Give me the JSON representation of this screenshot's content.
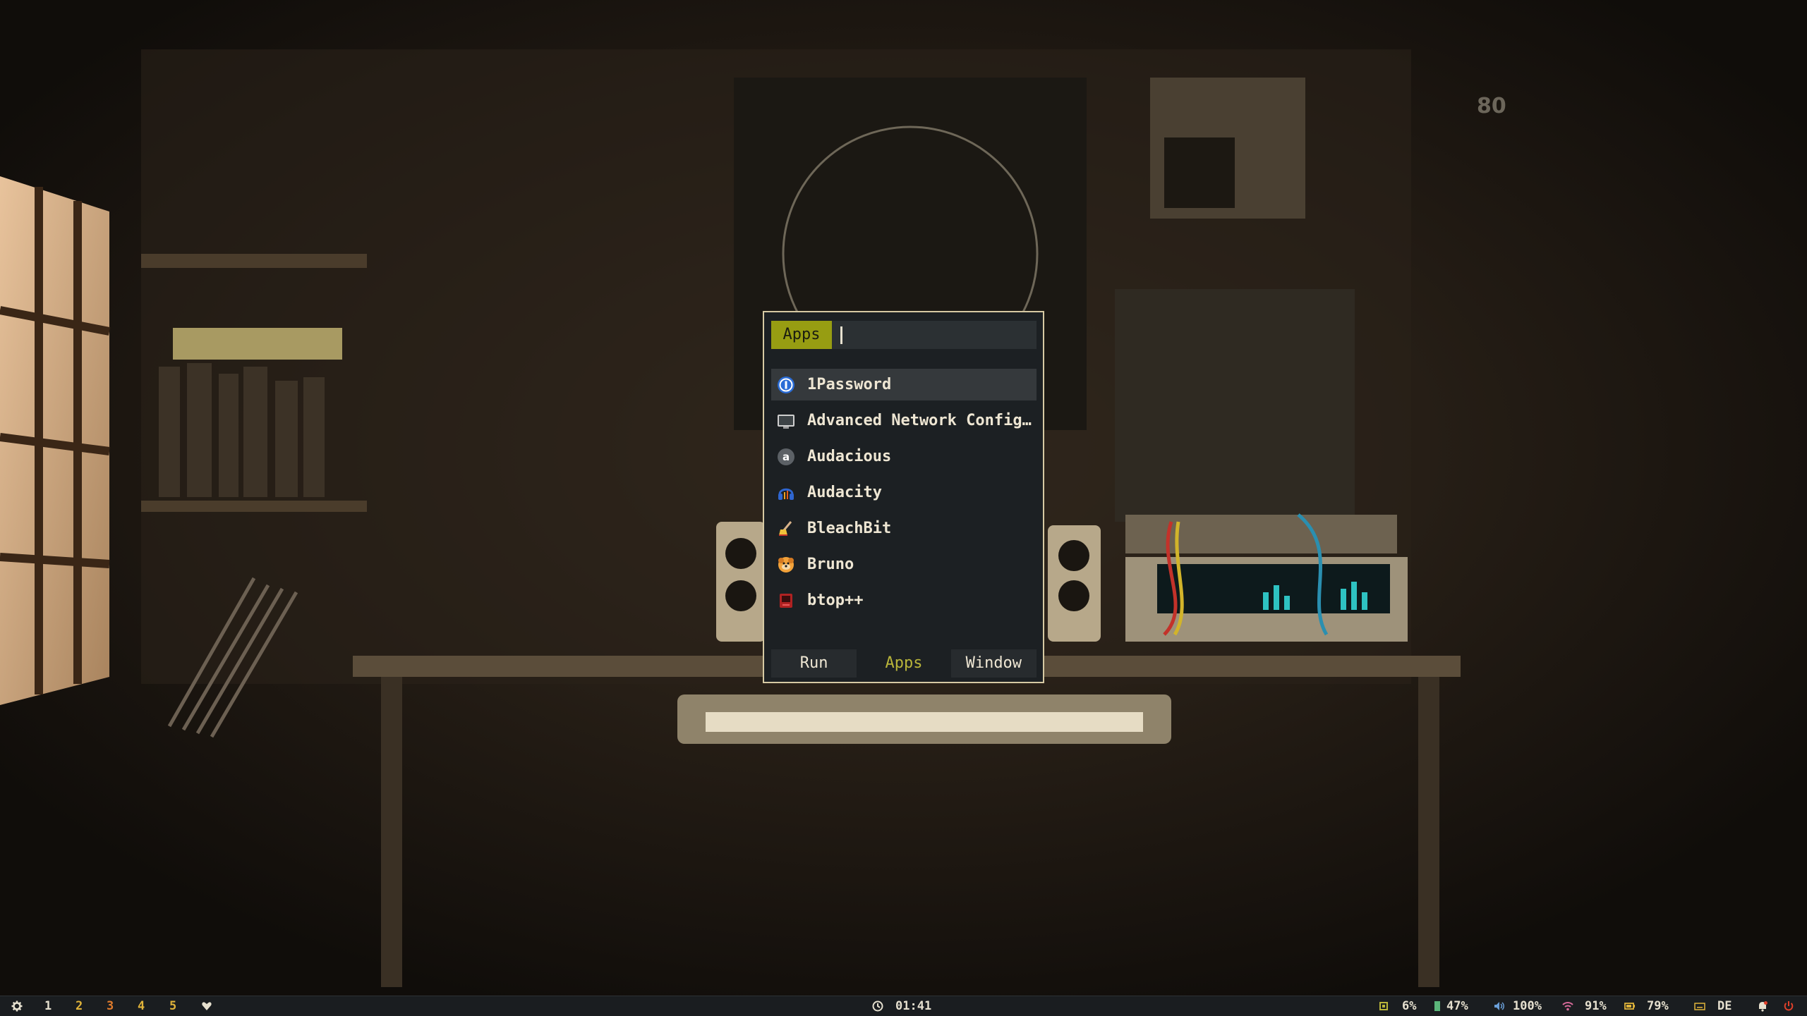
{
  "launcher": {
    "mode_badge": "Apps",
    "search": {
      "value": "",
      "placeholder": ""
    },
    "selected_index": 0,
    "items": [
      {
        "label": "1Password",
        "icon": "1password-icon"
      },
      {
        "label": "Advanced Network Config…",
        "icon": "network-config-icon"
      },
      {
        "label": "Audacious",
        "icon": "audacious-icon"
      },
      {
        "label": "Audacity",
        "icon": "audacity-icon"
      },
      {
        "label": "BleachBit",
        "icon": "bleachbit-icon"
      },
      {
        "label": "Bruno",
        "icon": "bruno-icon"
      },
      {
        "label": "btop++",
        "icon": "btop-icon"
      }
    ],
    "modes": [
      {
        "label": "Run",
        "active": false
      },
      {
        "label": "Apps",
        "active": true
      },
      {
        "label": "Window",
        "active": false
      }
    ]
  },
  "taskbar": {
    "workspaces": [
      {
        "label": "1",
        "color": "#e6e0cf"
      },
      {
        "label": "2",
        "color": "#e0b33a"
      },
      {
        "label": "3",
        "color": "#e07b2c"
      },
      {
        "label": "4",
        "color": "#e0b33a"
      },
      {
        "label": "5",
        "color": "#e0b33a"
      }
    ],
    "clock": "01:41",
    "cpu": "6%",
    "memory": "47%",
    "volume": "100%",
    "wifi": "91%",
    "battery": "79%",
    "keyboard_layout": "DE"
  },
  "colors": {
    "accent": "#979d12",
    "active_tab_text": "#b9b53a",
    "launcher_bg": "#1c2023",
    "launcher_border": "#d6c9a3",
    "power": "#e0402a"
  }
}
